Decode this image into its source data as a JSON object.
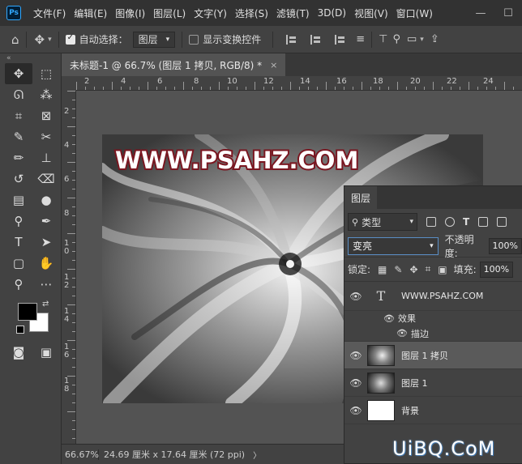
{
  "app": {
    "logo": "Ps"
  },
  "menu": {
    "items": [
      "文件(F)",
      "编辑(E)",
      "图像(I)",
      "图层(L)",
      "文字(Y)",
      "选择(S)",
      "滤镜(T)",
      "3D(D)",
      "视图(V)",
      "窗口(W)"
    ],
    "window_controls": [
      "—",
      "☐"
    ]
  },
  "options": {
    "auto_select_label": "自动选择：",
    "auto_select_checked": true,
    "target_value": "图层",
    "show_transform_label": "显示变换控件",
    "show_transform_checked": false
  },
  "document": {
    "tab_title": "未标题-1 @ 66.7% (图层 1 拷贝, RGB/8) *",
    "close_glyph": "×"
  },
  "rulers": {
    "h_labels": [
      "2",
      "4",
      "6",
      "8",
      "10",
      "12",
      "14",
      "16",
      "18",
      "20",
      "22",
      "24"
    ],
    "v_labels": [
      "2",
      "4",
      "6",
      "8",
      "1\n0",
      "1\n2",
      "1\n4",
      "1\n6",
      "1\n8"
    ]
  },
  "artwork": {
    "headline": "WWW.PSAHZ.COM",
    "headline_fill": "#ffffff",
    "headline_stroke": "#7a1620"
  },
  "status": {
    "zoom": "66.67%",
    "dimensions": "24.69 厘米 x 17.64 厘米 (72 ppi)",
    "arrow": "〉"
  },
  "layers_panel": {
    "tab_label": "图层",
    "filter_value": "类型",
    "blend_mode": "变亮",
    "opacity_label": "不透明度:",
    "opacity_value": "100%",
    "lock_label": "锁定:",
    "fill_label": "填充:",
    "fill_value": "100%",
    "layers": [
      {
        "name": "WWW.PSAHZ.COM",
        "kind": "text",
        "thumb_glyph": "T"
      },
      {
        "name": "图层 1 拷贝",
        "kind": "image",
        "selected": true
      },
      {
        "name": "图层 1",
        "kind": "image"
      },
      {
        "name": "背景",
        "kind": "background"
      }
    ],
    "effects_label": "效果",
    "stroke_label": "描边"
  },
  "watermark": "UiBQ.CoM",
  "colors": {
    "foreground": "#000000",
    "background": "#ffffff",
    "accent": "#31a8ff"
  }
}
